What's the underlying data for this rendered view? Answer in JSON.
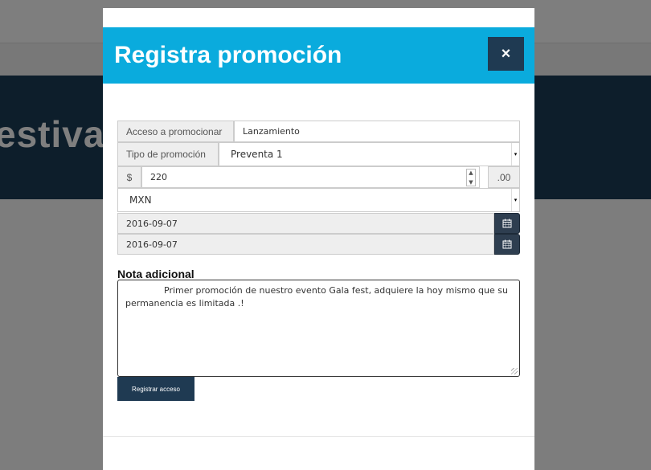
{
  "background": {
    "hero_title": "estiva"
  },
  "modal": {
    "title": "Registra promoción",
    "close_label": "×",
    "fields": {
      "access_label": "Acceso a promocionar",
      "access_value": "Lanzamiento",
      "promo_type_label": "Tipo de promoción",
      "promo_type_value": "Preventa 1",
      "price_prefix": "$",
      "price_value": "220",
      "price_suffix": ".00",
      "currency_value": "MXN",
      "date_start": "2016-09-07",
      "date_end": "2016-09-07"
    },
    "note": {
      "label": "Nota adicional",
      "text": "Primer promoción de nuestro evento Gala fest, adquiere la hoy mismo que su permanencia  es limitada .!"
    },
    "submit_label": "Registrar acceso"
  },
  "colors": {
    "header": "#0aabdd",
    "dark_button": "#1f3a52",
    "overlay": "rgba(0,0,0,0.5)"
  },
  "icons": {
    "close": "close-icon",
    "calendar": "calendar-icon"
  }
}
